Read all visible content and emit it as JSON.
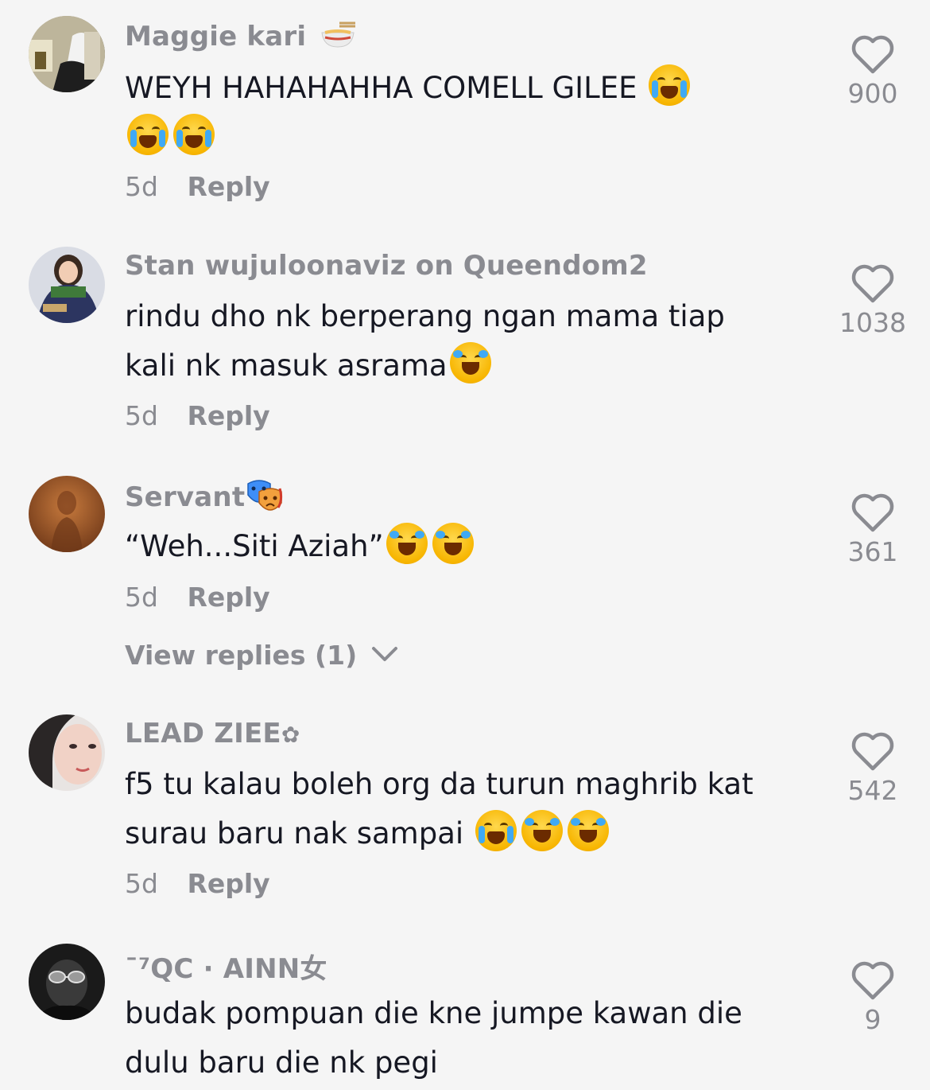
{
  "comments": [
    {
      "username": "Maggie kari",
      "text_lines": [
        "WEYH HAHAHAHHA COMELL GILEE"
      ],
      "time": "5d",
      "reply": "Reply",
      "likes": "900"
    },
    {
      "username": "Stan wujuloonaviz on Queendom2",
      "text_line1": "rindu dho nk berperang ngan mama tiap",
      "text_line2": "kali nk masuk asrama",
      "time": "5d",
      "reply": "Reply",
      "likes": "1038"
    },
    {
      "username": "Servant",
      "text": "“Weh...Siti Aziah”",
      "time": "5d",
      "reply": "Reply",
      "likes": "361",
      "view_replies": "View replies (1)"
    },
    {
      "username": "LEAD ZIEE",
      "username_symbol": "✿",
      "text_line1": "f5 tu kalau boleh org da turun maghrib kat",
      "text_line2": "surau baru nak sampai",
      "time": "5d",
      "reply": "Reply",
      "likes": "542"
    },
    {
      "username": "¯⁷QC · AINN女",
      "text_line1": "budak pompuan die kne jumpe kawan die",
      "text_line2": "dulu baru die nk pegi",
      "likes": "9"
    }
  ],
  "icons": {
    "like": "heart-outline-icon",
    "expand": "chevron-down-icon"
  },
  "colors": {
    "background": "#f5f5f5",
    "muted_text": "#8a8b91",
    "body_text": "#161823"
  }
}
